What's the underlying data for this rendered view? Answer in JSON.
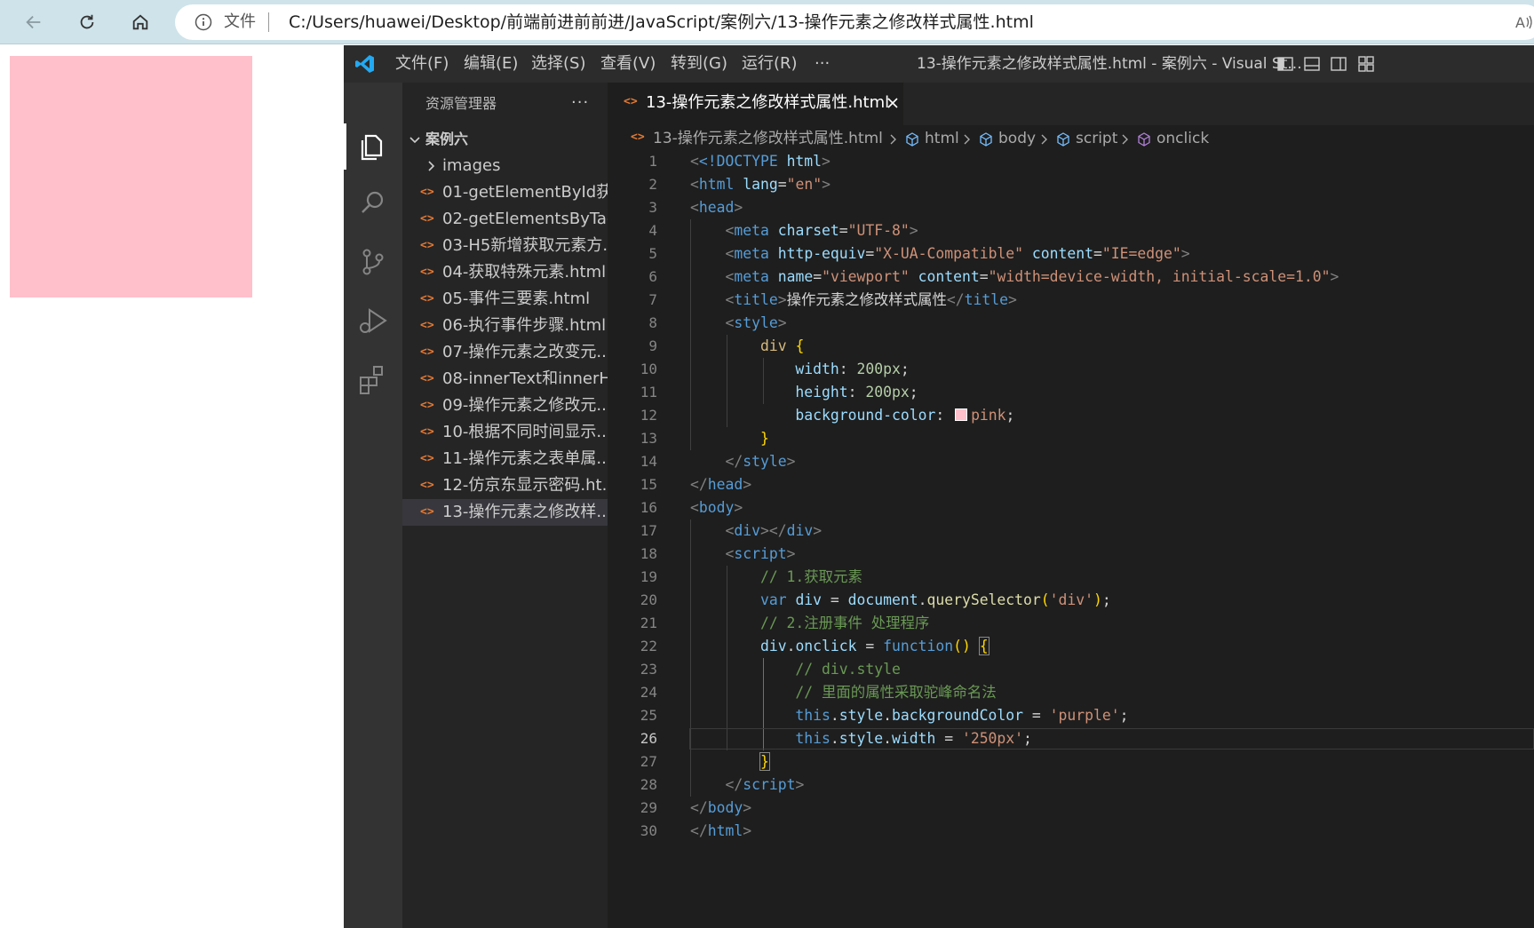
{
  "browser": {
    "addr_label": "文件",
    "url": "C:/Users/huawei/Desktop/前端前进前前进/JavaScript/案例六/13-操作元素之修改样式属性.html"
  },
  "page": {
    "box_color": "#ffc0cb"
  },
  "vscode": {
    "menu": [
      "文件(F)",
      "编辑(E)",
      "选择(S)",
      "查看(V)",
      "转到(G)",
      "运行(R)",
      "···"
    ],
    "window_title": "13-操作元素之修改样式属性.html - 案例六 - Visual St...",
    "explorer": {
      "title": "资源管理器",
      "more": "···",
      "folder": "案例六",
      "items": [
        "images",
        "01-getElementById获...",
        "02-getElementsByTag...",
        "03-H5新增获取元素方...",
        "04-获取特殊元素.html",
        "05-事件三要素.html",
        "06-执行事件步骤.html",
        "07-操作元素之改变元...",
        "08-innerText和innerH...",
        "09-操作元素之修改元...",
        "10-根据不同时间显示...",
        "11-操作元素之表单属...",
        "12-仿京东显示密码.ht...",
        "13-操作元素之修改样..."
      ]
    },
    "tab": {
      "label": "13-操作元素之修改样式属性.html"
    },
    "breadcrumb": [
      "13-操作元素之修改样式属性.html",
      "html",
      "body",
      "script",
      "onclick"
    ],
    "code_lines": [
      "1",
      "2",
      "3",
      "4",
      "5",
      "6",
      "7",
      "8",
      "9",
      "10",
      "11",
      "12",
      "13",
      "14",
      "15",
      "16",
      "17",
      "18",
      "19",
      "20",
      "21",
      "22",
      "23",
      "24",
      "25",
      "26",
      "27",
      "28",
      "29",
      "30"
    ],
    "current_line": "26",
    "code": {
      "doctype": "<!DOCTYPE",
      "html_kw": "html",
      "lang_attr": "lang",
      "lang_val": "\"en\"",
      "charset_attr": "charset",
      "charset_val": "\"UTF-8\"",
      "httpequiv_attr": "http-equiv",
      "httpequiv_val": "\"X-UA-Compatible\"",
      "content_attr": "content",
      "content_val": "\"IE=edge\"",
      "name_attr": "name",
      "name_val": "\"viewport\"",
      "viewport_val": "\"width=device-width, initial-scale=1.0\"",
      "title_text": "操作元素之修改样式属性",
      "css_selector": "div",
      "css_width": "width",
      "css_width_val": "200px",
      "css_height": "height",
      "css_height_val": "200px",
      "css_bg": "background-color",
      "css_bg_val": "pink",
      "comment1": "// 1.获取元素",
      "var_kw": "var",
      "var_name": "div",
      "document": "document",
      "query_fn": "querySelector",
      "query_arg": "'div'",
      "comment2": "// 2.注册事件 处理程序",
      "onclick_obj": "div",
      "onclick_prop": "onclick",
      "function_kw": "function",
      "comment3": "// div.style",
      "comment4": "// 里面的属性采取驼峰命名法",
      "this_kw": "this",
      "style_prop": "style",
      "bgcolor_prop": "backgroundColor",
      "bgcolor_val": "'purple'",
      "width_prop": "width",
      "width_val": "'250px'"
    }
  }
}
